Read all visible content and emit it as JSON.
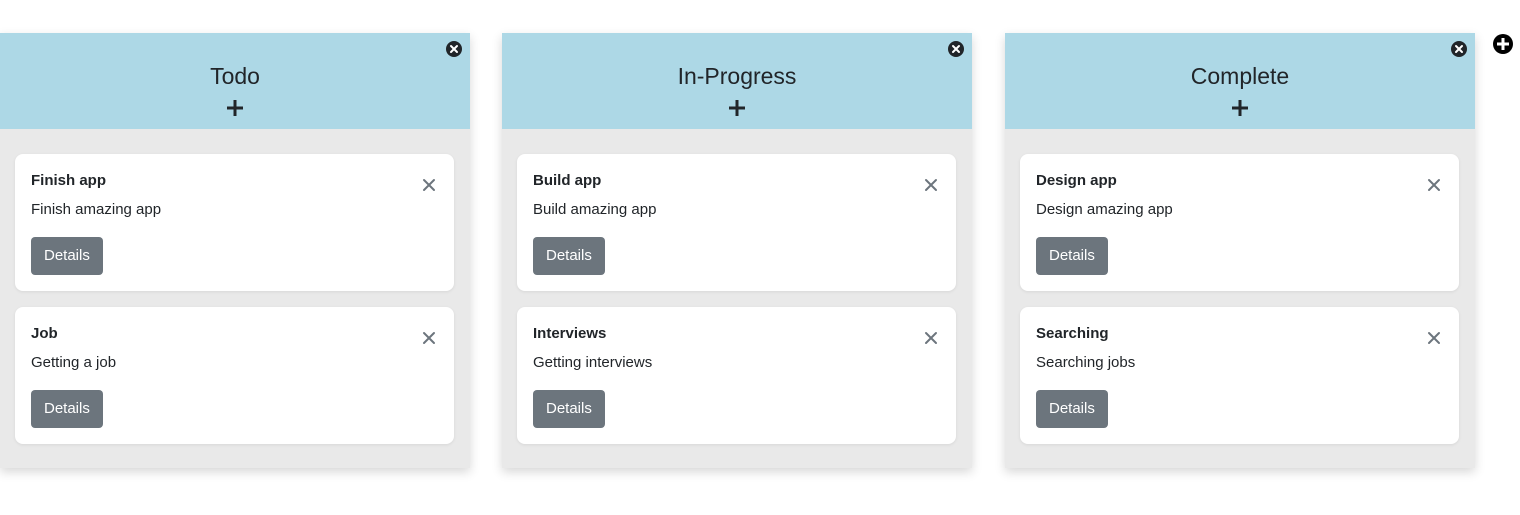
{
  "columns": [
    {
      "title": "Todo",
      "cards": [
        {
          "title": "Finish app",
          "description": "Finish amazing app",
          "button": "Details"
        },
        {
          "title": "Job",
          "description": "Getting a job",
          "button": "Details"
        }
      ]
    },
    {
      "title": "In-Progress",
      "cards": [
        {
          "title": "Build app",
          "description": "Build amazing app",
          "button": "Details"
        },
        {
          "title": "Interviews",
          "description": "Getting interviews",
          "button": "Details"
        }
      ]
    },
    {
      "title": "Complete",
      "cards": [
        {
          "title": "Design app",
          "description": "Design amazing app",
          "button": "Details"
        },
        {
          "title": "Searching",
          "description": "Searching jobs",
          "button": "Details"
        }
      ]
    }
  ],
  "icons": {
    "column_add": "plus-icon",
    "column_remove": "close-circle-icon",
    "card_remove": "close-icon",
    "add_column": "plus-circle-icon"
  },
  "colors": {
    "column_header": "#add8e6",
    "column_body": "#e9e9e9",
    "card": "#ffffff",
    "button": "#6c757d"
  }
}
